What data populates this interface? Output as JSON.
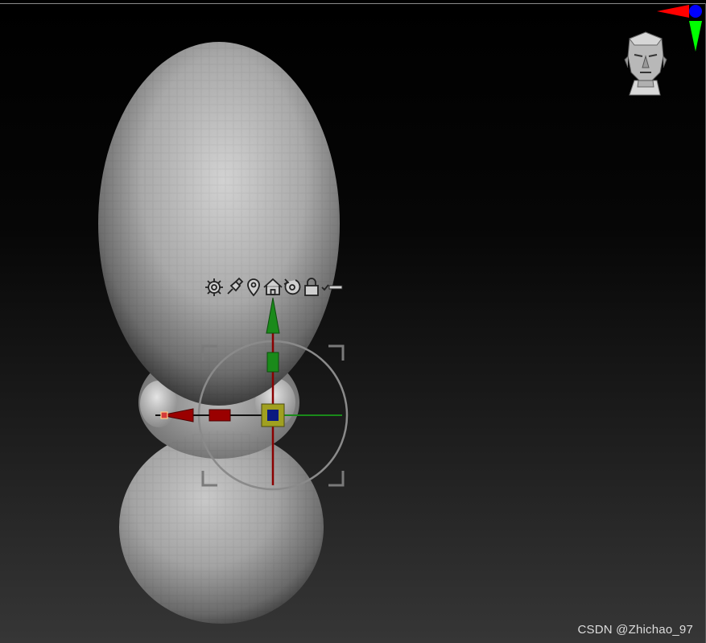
{
  "viewport": {
    "background_top": "#000000",
    "background_bottom": "#363636"
  },
  "gizmo": {
    "icons": [
      "gear-icon",
      "pin-icon",
      "location-marker-icon",
      "home-icon",
      "rotate-reset-icon",
      "lock-icon",
      "checkmark-icon"
    ],
    "colors": {
      "x_axis": "#a00000",
      "y_axis": "#1a8a1a",
      "z_axis": "#0a1a80",
      "center": "#a0a020"
    }
  },
  "navigator": {
    "icon": "head-orientation-icon",
    "axis_colors": {
      "x": "#ff0000",
      "y": "#00ff00",
      "z": "#0000ff"
    }
  },
  "watermark": "CSDN @Zhichao_97"
}
